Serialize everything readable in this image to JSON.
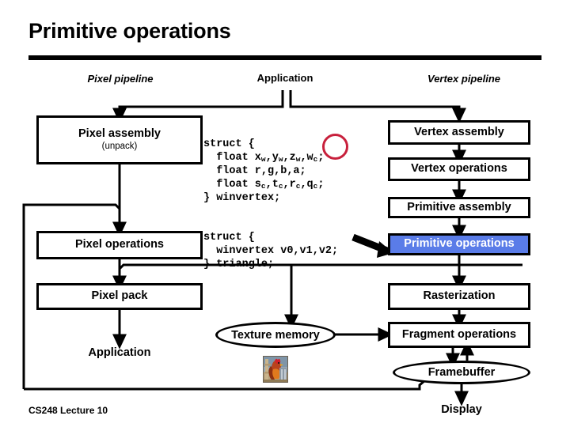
{
  "slide": {
    "title": "Primitive operations",
    "footer": "CS248 Lecture 10"
  },
  "columns": {
    "left_heading": "Pixel pipeline",
    "center_heading": "Application",
    "right_heading": "Vertex pipeline"
  },
  "pixel_pipeline": {
    "assembly_title": "Pixel assembly",
    "assembly_subtitle": "(unpack)",
    "operations": "Pixel operations",
    "pack": "Pixel pack",
    "application": "Application"
  },
  "vertex_pipeline": {
    "vertex_assembly": "Vertex assembly",
    "vertex_operations": "Vertex operations",
    "primitive_assembly": "Primitive assembly",
    "primitive_operations": "Primitive operations",
    "rasterization": "Rasterization",
    "fragment_operations": "Fragment operations",
    "framebuffer": "Framebuffer",
    "display": "Display"
  },
  "shared": {
    "texture_memory": "Texture memory",
    "texture_image_alt": "rooster-texture"
  },
  "code": {
    "winvertex": {
      "line1": "struct {",
      "line2_prefix": "  float x",
      "line2_sub1": "w",
      "line2_mid1": ",y",
      "line2_sub2": "w",
      "line2_mid2": ",z",
      "line2_sub3": "w",
      "line2_mid3": ",w",
      "line2_sub4": "c",
      "line2_suffix": ";",
      "line3": "  float r,g,b,a;",
      "line4_prefix": "  float s",
      "line4_sub1": "c",
      "line4_mid1": ",t",
      "line4_sub2": "c",
      "line4_mid2": ",r",
      "line4_sub3": "c",
      "line4_mid3": ",q",
      "line4_sub4": "c",
      "line4_suffix": ";",
      "line5": "} winvertex;"
    },
    "triangle": {
      "line1": "struct {",
      "line2": "  winvertex v0,v1,v2;",
      "line3": "} triangle;"
    }
  },
  "annotations": {
    "highlight_color": "#5a7ce8",
    "highlight_text_color": "#ffffff",
    "circle_color": "#c8203c",
    "circle_target": "w_c",
    "pointer_arrow_target": "Primitive operations"
  }
}
